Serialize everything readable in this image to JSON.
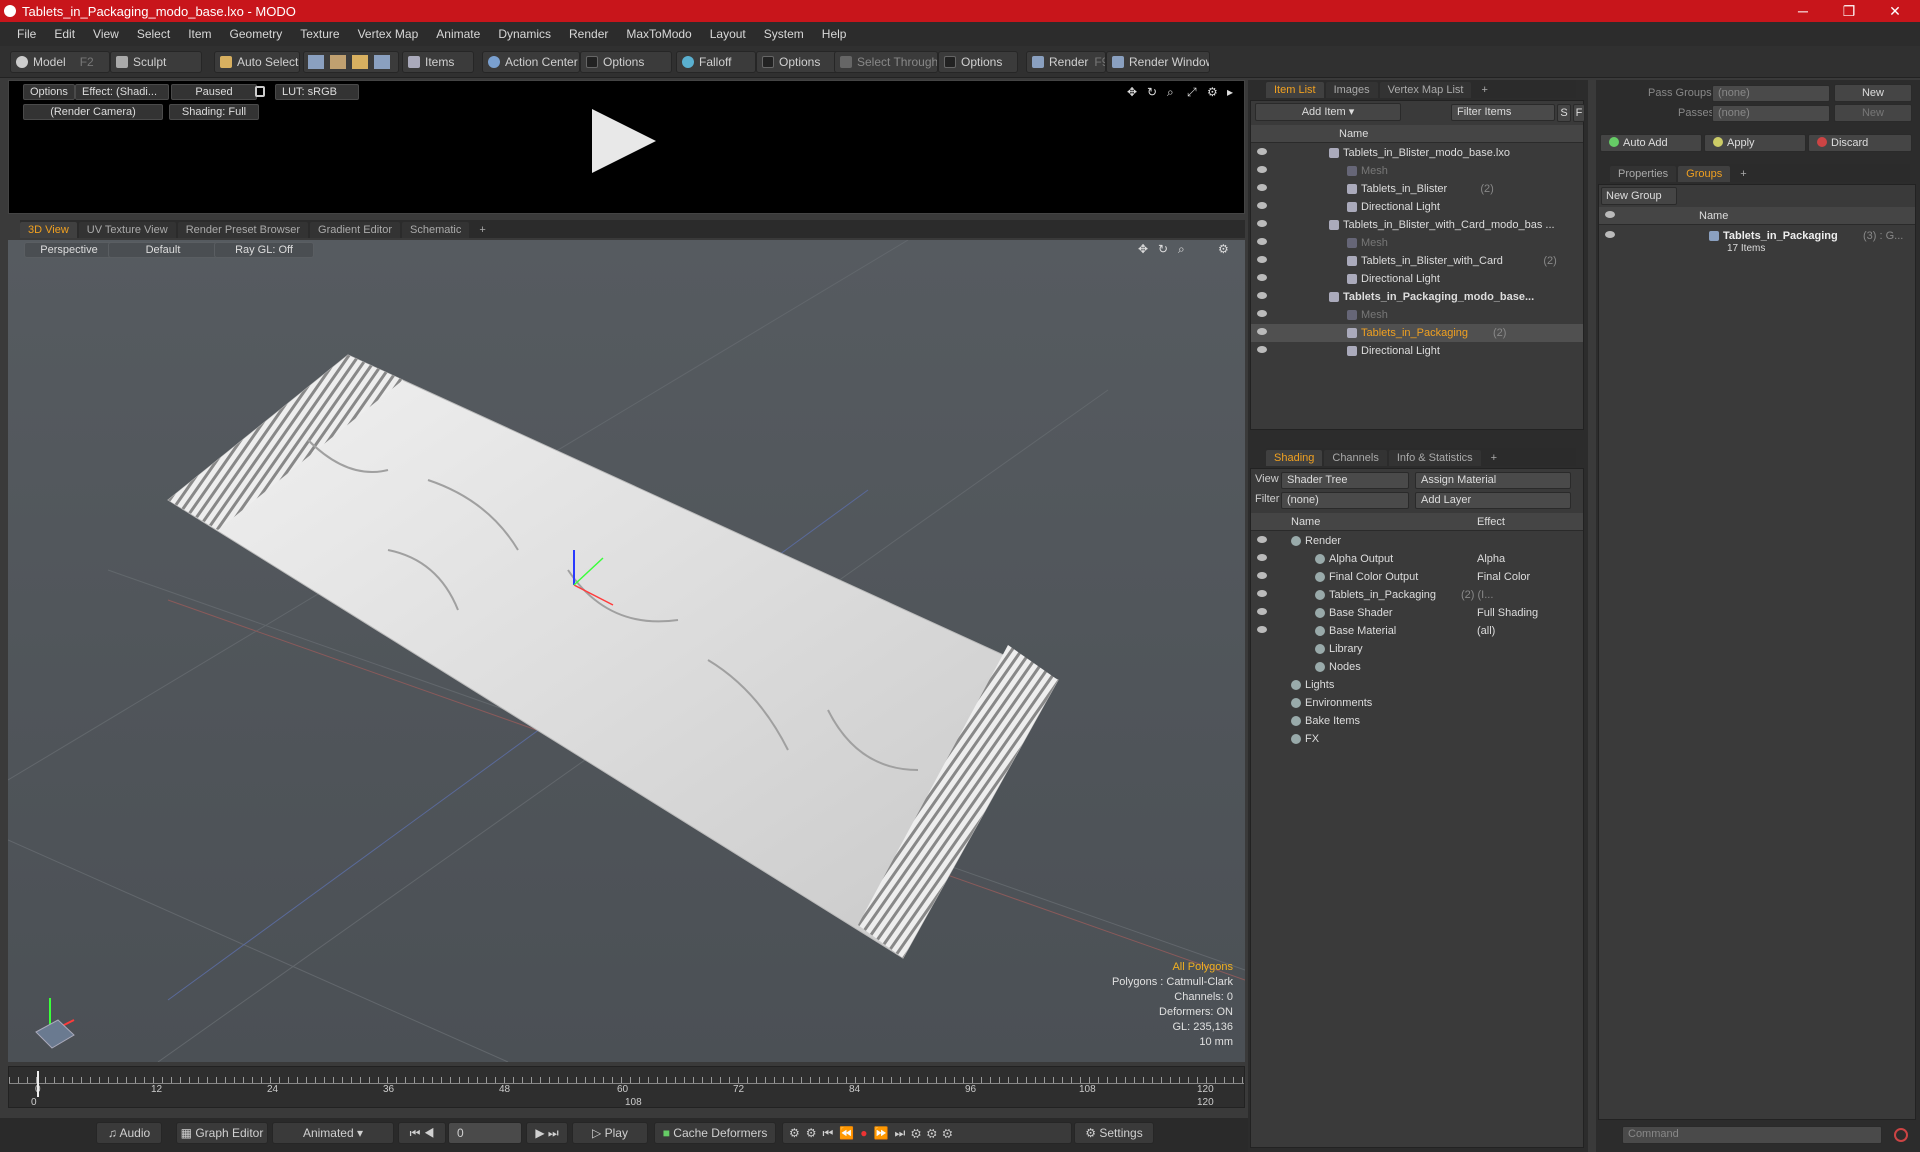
{
  "window": {
    "title": "Tablets_in_Packaging_modo_base.lxo - MODO",
    "minimize": "─",
    "maximize": "❐",
    "close": "✕"
  },
  "menu": [
    "File",
    "Edit",
    "View",
    "Select",
    "Item",
    "Geometry",
    "Texture",
    "Vertex Map",
    "Animate",
    "Dynamics",
    "Render",
    "MaxToModo",
    "Layout",
    "System",
    "Help"
  ],
  "toolbar": {
    "model": "Model",
    "model_key": "F2",
    "sculpt": "Sculpt",
    "auto_select": "Auto Select",
    "items": "Items",
    "action_center": "Action Center",
    "options1": "Options",
    "falloff": "Falloff",
    "options2": "Options",
    "select_through": "Select Through",
    "options3": "Options",
    "render": "Render",
    "render_key": "F9",
    "render_window": "Render Window"
  },
  "render_view": {
    "options": "Options",
    "effect": "Effect: (Shadi...",
    "paused": "Paused",
    "lut": "LUT: sRGB",
    "camera": "(Render Camera)",
    "shading": "Shading: Full"
  },
  "view_tabs": [
    "3D View",
    "UV Texture View",
    "Render Preset Browser",
    "Gradient Editor",
    "Schematic",
    "+"
  ],
  "viewport": {
    "perspective": "Perspective",
    "default": "Default",
    "raygl": "Ray GL: Off",
    "stats": [
      "All Polygons",
      "Polygons : Catmull-Clark",
      "Channels: 0",
      "Deformers: ON",
      "GL: 235,136",
      "10 mm"
    ]
  },
  "timeline": {
    "ticks": [
      "0",
      "12",
      "24",
      "36",
      "48",
      "60",
      "72",
      "84",
      "96",
      "108",
      "120"
    ],
    "end": "120",
    "start": "0"
  },
  "bottom": {
    "audio": "Audio",
    "graph_editor": "Graph Editor",
    "animated": "Animated",
    "frame": "0",
    "play": "Play",
    "cache_deformers": "Cache Deformers",
    "settings": "Settings"
  },
  "item_list": {
    "tabs": [
      "Item List",
      "Images",
      "Vertex Map List",
      "+"
    ],
    "add_item": "Add Item",
    "filter_items": "Filter Items",
    "s": "S",
    "f": "F",
    "col_name": "Name",
    "rows": [
      {
        "label": "Tablets_in_Blister_modo_base.lxo",
        "indent": 1,
        "count": ""
      },
      {
        "label": "Mesh",
        "indent": 2,
        "count": "",
        "dim": true
      },
      {
        "label": "Tablets_in_Blister",
        "indent": 2,
        "count": "(2)"
      },
      {
        "label": "Directional Light",
        "indent": 2,
        "count": ""
      },
      {
        "label": "Tablets_in_Blister_with_Card_modo_bas ...",
        "indent": 1,
        "count": ""
      },
      {
        "label": "Mesh",
        "indent": 2,
        "count": "",
        "dim": true
      },
      {
        "label": "Tablets_in_Blister_with_Card",
        "indent": 2,
        "count": "(2)"
      },
      {
        "label": "Directional Light",
        "indent": 2,
        "count": ""
      },
      {
        "label": "Tablets_in_Packaging_modo_base...",
        "indent": 1,
        "count": "",
        "bold": true
      },
      {
        "label": "Mesh",
        "indent": 2,
        "count": "",
        "dim": true
      },
      {
        "label": "Tablets_in_Packaging",
        "indent": 2,
        "count": "(2)",
        "selected": true
      },
      {
        "label": "Directional Light",
        "indent": 2,
        "count": ""
      }
    ]
  },
  "shading": {
    "tabs": [
      "Shading",
      "Channels",
      "Info & Statistics",
      "+"
    ],
    "view_label": "View",
    "view_value": "Shader Tree",
    "assign_material": "Assign Material",
    "filter_label": "Filter",
    "filter_value": "(none)",
    "add_layer": "Add Layer",
    "col_name": "Name",
    "col_effect": "Effect",
    "rows": [
      {
        "label": "Render",
        "effect": "",
        "indent": 1
      },
      {
        "label": "Alpha Output",
        "effect": "Alpha",
        "indent": 2
      },
      {
        "label": "Final Color Output",
        "effect": "Final Color",
        "indent": 2
      },
      {
        "label": "Tablets_in_Packaging",
        "count": "(2) (I...",
        "effect": "",
        "indent": 2
      },
      {
        "label": "Base Shader",
        "effect": "Full Shading",
        "indent": 2
      },
      {
        "label": "Base Material",
        "effect": "(all)",
        "indent": 2
      },
      {
        "label": "Library",
        "effect": "",
        "indent": 2
      },
      {
        "label": "Nodes",
        "effect": "",
        "indent": 2
      },
      {
        "label": "Lights",
        "effect": "",
        "indent": 1
      },
      {
        "label": "Environments",
        "effect": "",
        "indent": 1
      },
      {
        "label": "Bake Items",
        "effect": "",
        "indent": 1
      },
      {
        "label": "FX",
        "effect": "",
        "indent": 1
      }
    ]
  },
  "groups": {
    "pass_groups_label": "Pass Groups",
    "pass_groups_value": "(none)",
    "new1": "New",
    "passes_label": "Passes",
    "passes_value": "(none)",
    "new2": "New",
    "auto_add": "Auto Add",
    "apply": "Apply",
    "discard": "Discard",
    "tabs": [
      "Properties",
      "Groups",
      "+"
    ],
    "new_group": "New Group",
    "col_name": "Name",
    "group_name": "Tablets_in_Packaging",
    "group_count": "(3) : G...",
    "group_items": "17 Items",
    "command_placeholder": "Command"
  }
}
